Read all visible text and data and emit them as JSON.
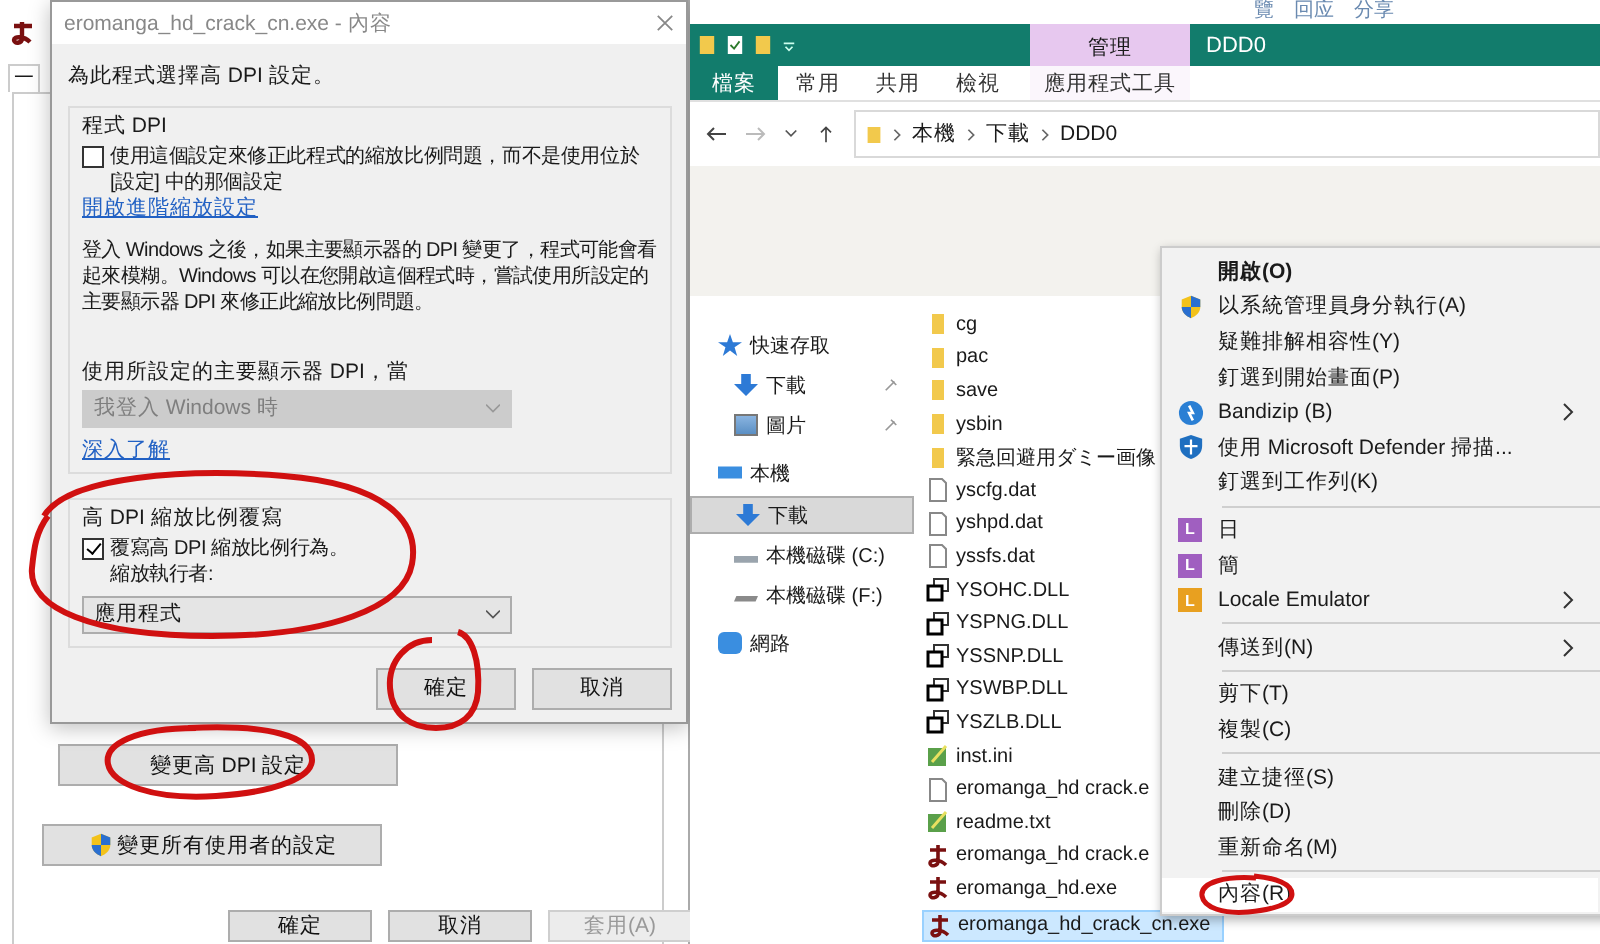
{
  "background_links": [
    "覽",
    "回应",
    "分享"
  ],
  "back_window": {
    "tab": "一",
    "change_dpi_button": "變更高 DPI 設定",
    "all_users_button": "變更所有使用者的設定",
    "buttons": [
      {
        "label": "確定",
        "disabled": false
      },
      {
        "label": "取消",
        "disabled": false
      },
      {
        "label": "套用(A)",
        "disabled": true
      }
    ]
  },
  "dialog": {
    "title": "eromanga_hd_crack_cn.exe - 內容",
    "heading": "為此程式選擇高 DPI 設定。",
    "program_dpi": {
      "legend": "程式 DPI",
      "checkbox": {
        "label": "使用這個設定來修正此程式的縮放比例問題，而不是使用位於 [設定] 中的那個設定",
        "checked": false
      },
      "link": "開啟進階縮放設定",
      "description": "登入 Windows 之後，如果主要顯示器的 DPI 變更了，程式可能會看起來模糊。Windows 可以在您開啟這個程式時，嘗試使用所設定的主要顯示器 DPI 來修正此縮放比例問題。",
      "select_label": "使用所設定的主要顯示器 DPI，當",
      "select": {
        "value": "我登入 Windows 時",
        "disabled": true
      },
      "learn_more": "深入了解"
    },
    "override": {
      "legend": "高 DPI 縮放比例覆寫",
      "checkbox": {
        "label": "覆寫高 DPI 縮放比例行為。",
        "sublabel": "縮放執行者:",
        "checked": true
      },
      "select": {
        "value": "應用程式",
        "disabled": false
      }
    },
    "buttons": [
      "確定",
      "取消"
    ]
  },
  "explorer": {
    "title": "DDD0",
    "context_tab": "管理",
    "tabs": [
      {
        "label": "檔案",
        "kind": "file"
      },
      {
        "label": "常用",
        "kind": "normal"
      },
      {
        "label": "共用",
        "kind": "normal"
      },
      {
        "label": "檢視",
        "kind": "normal"
      },
      {
        "label": "應用程式工具",
        "kind": "contextual"
      }
    ],
    "path": [
      "本機",
      "下載",
      "DDD0"
    ],
    "nav": [
      {
        "label": "快速存取",
        "kind": "quick",
        "selected": false,
        "children": [
          {
            "label": "下載",
            "kind": "downloads",
            "selected": false,
            "pinned": true
          },
          {
            "label": "圖片",
            "kind": "pictures",
            "selected": false,
            "pinned": true
          }
        ]
      },
      {
        "label": "本機",
        "kind": "computer",
        "selected": false,
        "children": [
          {
            "label": "下載",
            "kind": "downloads",
            "selected": true,
            "pinned": false
          },
          {
            "label": "本機磁碟 (C:)",
            "kind": "drive",
            "selected": false,
            "pinned": false
          },
          {
            "label": "本機磁碟 (F:)",
            "kind": "removable",
            "selected": false,
            "pinned": false
          }
        ]
      },
      {
        "label": "網路",
        "kind": "network",
        "selected": false
      }
    ],
    "files": [
      {
        "name": "cg",
        "kind": "folder",
        "selected": false
      },
      {
        "name": "pac",
        "kind": "folder",
        "selected": false
      },
      {
        "name": "save",
        "kind": "folder",
        "selected": false
      },
      {
        "name": "ysbin",
        "kind": "folder",
        "selected": false
      },
      {
        "name": "緊急回避用ダミー画像",
        "kind": "folder",
        "selected": false
      },
      {
        "name": "yscfg.dat",
        "kind": "file",
        "selected": false
      },
      {
        "name": "yshpd.dat",
        "kind": "file",
        "selected": false
      },
      {
        "name": "yssfs.dat",
        "kind": "file",
        "selected": false
      },
      {
        "name": "YSOHC.DLL",
        "kind": "dll",
        "selected": false
      },
      {
        "name": "YSPNG.DLL",
        "kind": "dll",
        "selected": false
      },
      {
        "name": "YSSNP.DLL",
        "kind": "dll",
        "selected": false
      },
      {
        "name": "YSWBP.DLL",
        "kind": "dll",
        "selected": false
      },
      {
        "name": "YSZLB.DLL",
        "kind": "dll",
        "selected": false
      },
      {
        "name": "inst.ini",
        "kind": "text",
        "selected": false
      },
      {
        "name": "eromanga_hd crack.e",
        "kind": "file",
        "selected": false
      },
      {
        "name": "readme.txt",
        "kind": "text",
        "selected": false
      },
      {
        "name": "eromanga_hd crack.e",
        "kind": "app",
        "selected": false
      },
      {
        "name": "eromanga_hd.exe",
        "kind": "app",
        "selected": false
      },
      {
        "name": "eromanga_hd_crack_cn.exe",
        "kind": "app",
        "selected": true
      }
    ]
  },
  "context_menu": {
    "groups": [
      [
        {
          "label": "開啟(O)",
          "kind": "plain",
          "default": true,
          "submenu": false
        },
        {
          "label": "以系統管理員身分執行(A)",
          "kind": "admin",
          "default": false,
          "submenu": false
        },
        {
          "label": "疑難排解相容性(Y)",
          "kind": "plain",
          "default": false,
          "submenu": false
        },
        {
          "label": "釘選到開始畫面(P)",
          "kind": "plain",
          "default": false,
          "submenu": false
        },
        {
          "label": "Bandizip (B)",
          "kind": "archiver",
          "default": false,
          "submenu": true
        },
        {
          "label": "使用 Microsoft Defender 掃描...",
          "kind": "scanner",
          "default": false,
          "submenu": false
        },
        {
          "label": "釘選到工作列(K)",
          "kind": "plain",
          "default": false,
          "submenu": false
        }
      ],
      [
        {
          "label": "日",
          "kind": "emulator",
          "badge": "L",
          "color": "#a05fc0",
          "default": false,
          "submenu": false
        },
        {
          "label": "簡",
          "kind": "emulator",
          "badge": "L",
          "color": "#a05fc0",
          "default": false,
          "submenu": false
        },
        {
          "label": "Locale Emulator",
          "kind": "emulator",
          "badge": "L",
          "color": "#e8a020",
          "default": false,
          "submenu": true
        }
      ],
      [
        {
          "label": "傳送到(N)",
          "kind": "plain",
          "default": false,
          "submenu": true
        }
      ],
      [
        {
          "label": "剪下(T)",
          "kind": "plain",
          "default": false,
          "submenu": false
        },
        {
          "label": "複製(C)",
          "kind": "plain",
          "default": false,
          "submenu": false
        }
      ],
      [
        {
          "label": "建立捷徑(S)",
          "kind": "plain",
          "default": false,
          "submenu": false
        },
        {
          "label": "刪除(D)",
          "kind": "plain",
          "default": false,
          "submenu": false
        },
        {
          "label": "重新命名(M)",
          "kind": "plain",
          "default": false,
          "submenu": false
        }
      ],
      [
        {
          "label": "內容(R)",
          "kind": "plain",
          "default": false,
          "submenu": false
        }
      ]
    ]
  }
}
